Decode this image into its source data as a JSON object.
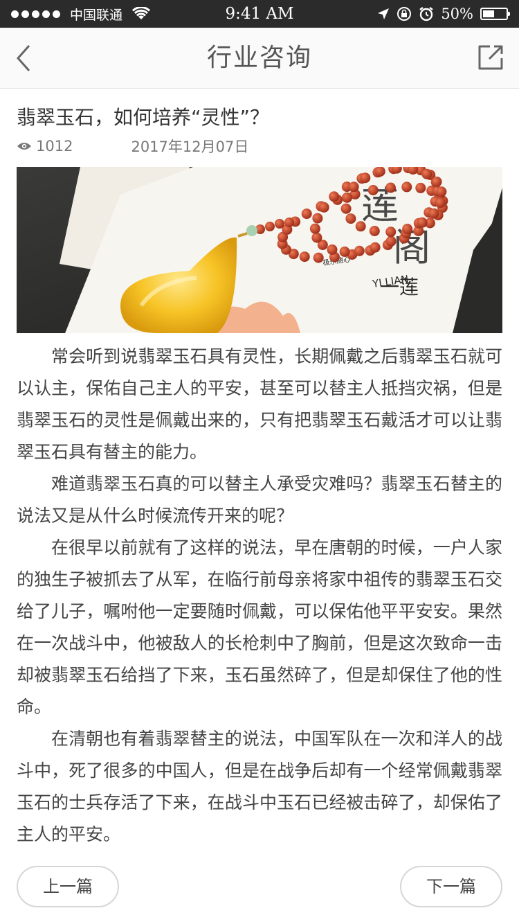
{
  "status_bar": {
    "carrier": "中国联通",
    "time": "9:41 AM",
    "battery_percent_text": "50%",
    "battery_level": 0.5
  },
  "nav": {
    "title": "行业咨询",
    "back_icon": "chevron-left-icon",
    "share_icon": "share-icon"
  },
  "article": {
    "title": "翡翠玉石，如何培养“灵性”？",
    "views": "1012",
    "date": "2017年12月07日",
    "paragraphs": [
      "常会听到说翡翠玉石具有灵性，长期佩戴之后翡翠玉石就可以认主，保佑自己主人的平安，甚至可以替主人抵挡灾祸，但是翡翠玉石的灵性是佩戴出来的，只有把翡翠玉石戴活才可以让翡翠玉石具有替主的能力。",
      "难道翡翠玉石真的可以替主人承受灾难吗？翡翠玉石替主的说法又是从什么时候流传开来的呢？",
      "在很早以前就有了这样的说法，早在唐朝的时候，一户人家的独生子被抓去了从军，在临行前母亲将家中祖传的翡翠玉石交给了儿子，嘱咐他一定要随时佩戴，可以保佑他平平安安。果然在一次战斗中，他被敌人的长枪刺中了胸前，但是这次致命一击却被翡翠玉石给挡了下来，玉石虽然碎了，但是却保住了他的性命。",
      "在清朝也有着翡翠替主的说法，中国军队在一次和洋人的战斗中，死了很多的中国人，但是在战争后却有一个经常佩戴翡翠玉石的士兵存活了下来，在战斗中玉石已经被击碎了，却保佑了主人的平安。"
    ]
  },
  "hero_image": {
    "card_text_1": "莲",
    "card_text_2": "阁",
    "card_text_3": "一莲",
    "card_text_4": "YI LIAN",
    "card_text_5": "极乐随心"
  },
  "footer": {
    "prev_label": "上一篇",
    "next_label": "下一篇"
  },
  "colors": {
    "status_bar_bg": "#2b2b2b",
    "nav_bg": "#fafafa",
    "text": "#444444",
    "amber": "#f5c21b",
    "bead": "#c8452a"
  }
}
